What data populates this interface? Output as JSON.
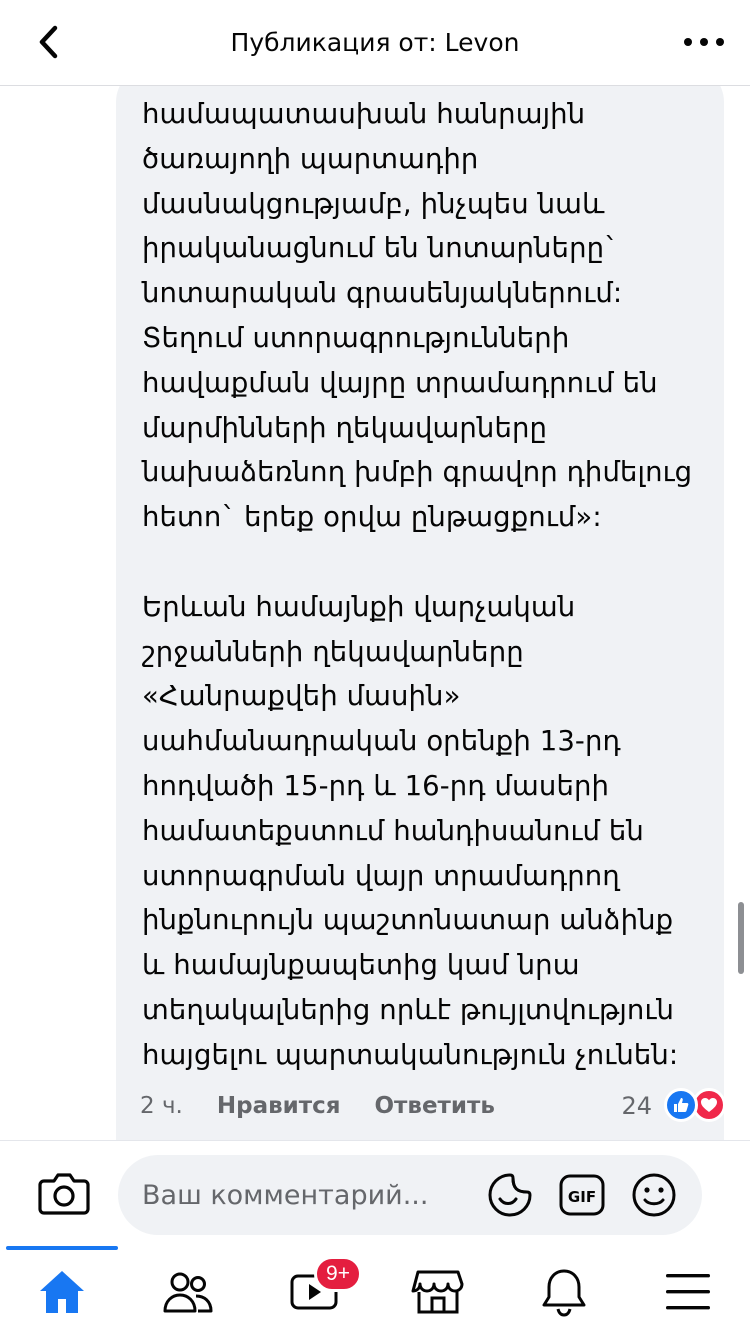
{
  "header": {
    "title": "Публикация от: Levon"
  },
  "comment": {
    "text": "համապատասխան հանրային\nծառայողի պարտադիր\nմասնակցությամբ, ինչպես նաև\nիրականացնում են նոտարները`\nնոտարական գրասենյակներում:\nՏեղում ստորագրությունների\nհավաքման վայրը տրամադրում են\nմարմինների ղեկավարները\nնախաձեռնող խմբի գրավոր դիմելուց\nհետո` երեք օրվա ընթացքում»:\n\nԵրևան համայնքի վարչական\nշրջանների ղեկավարները\n«Հանրաքվեի մասին»\nսահմանադրական օրենքի 13-րդ\nհոդվածի 15-րդ և 16-րդ մասերի\nհամատեքստում հանդիսանում են\nստորագրման վայր տրամադրող\nինքնուրույն պաշտոնատար անձինք\nև համայնքապետից կամ նրա\nտեղակալներից որևէ թույլտվություն\nհայցելու պարտականություն չունեն:",
    "time": "2 ч.",
    "like_label": "Нравится",
    "reply_label": "Ответить",
    "reaction_count": "24"
  },
  "composer": {
    "placeholder": "Ваш комментарий..."
  },
  "tabbar": {
    "active": "home",
    "video_badge": "9+"
  },
  "colors": {
    "accent": "#1877f2",
    "badge": "#e41e3f",
    "love": "#f0284a",
    "bubble": "#f0f2f5"
  }
}
